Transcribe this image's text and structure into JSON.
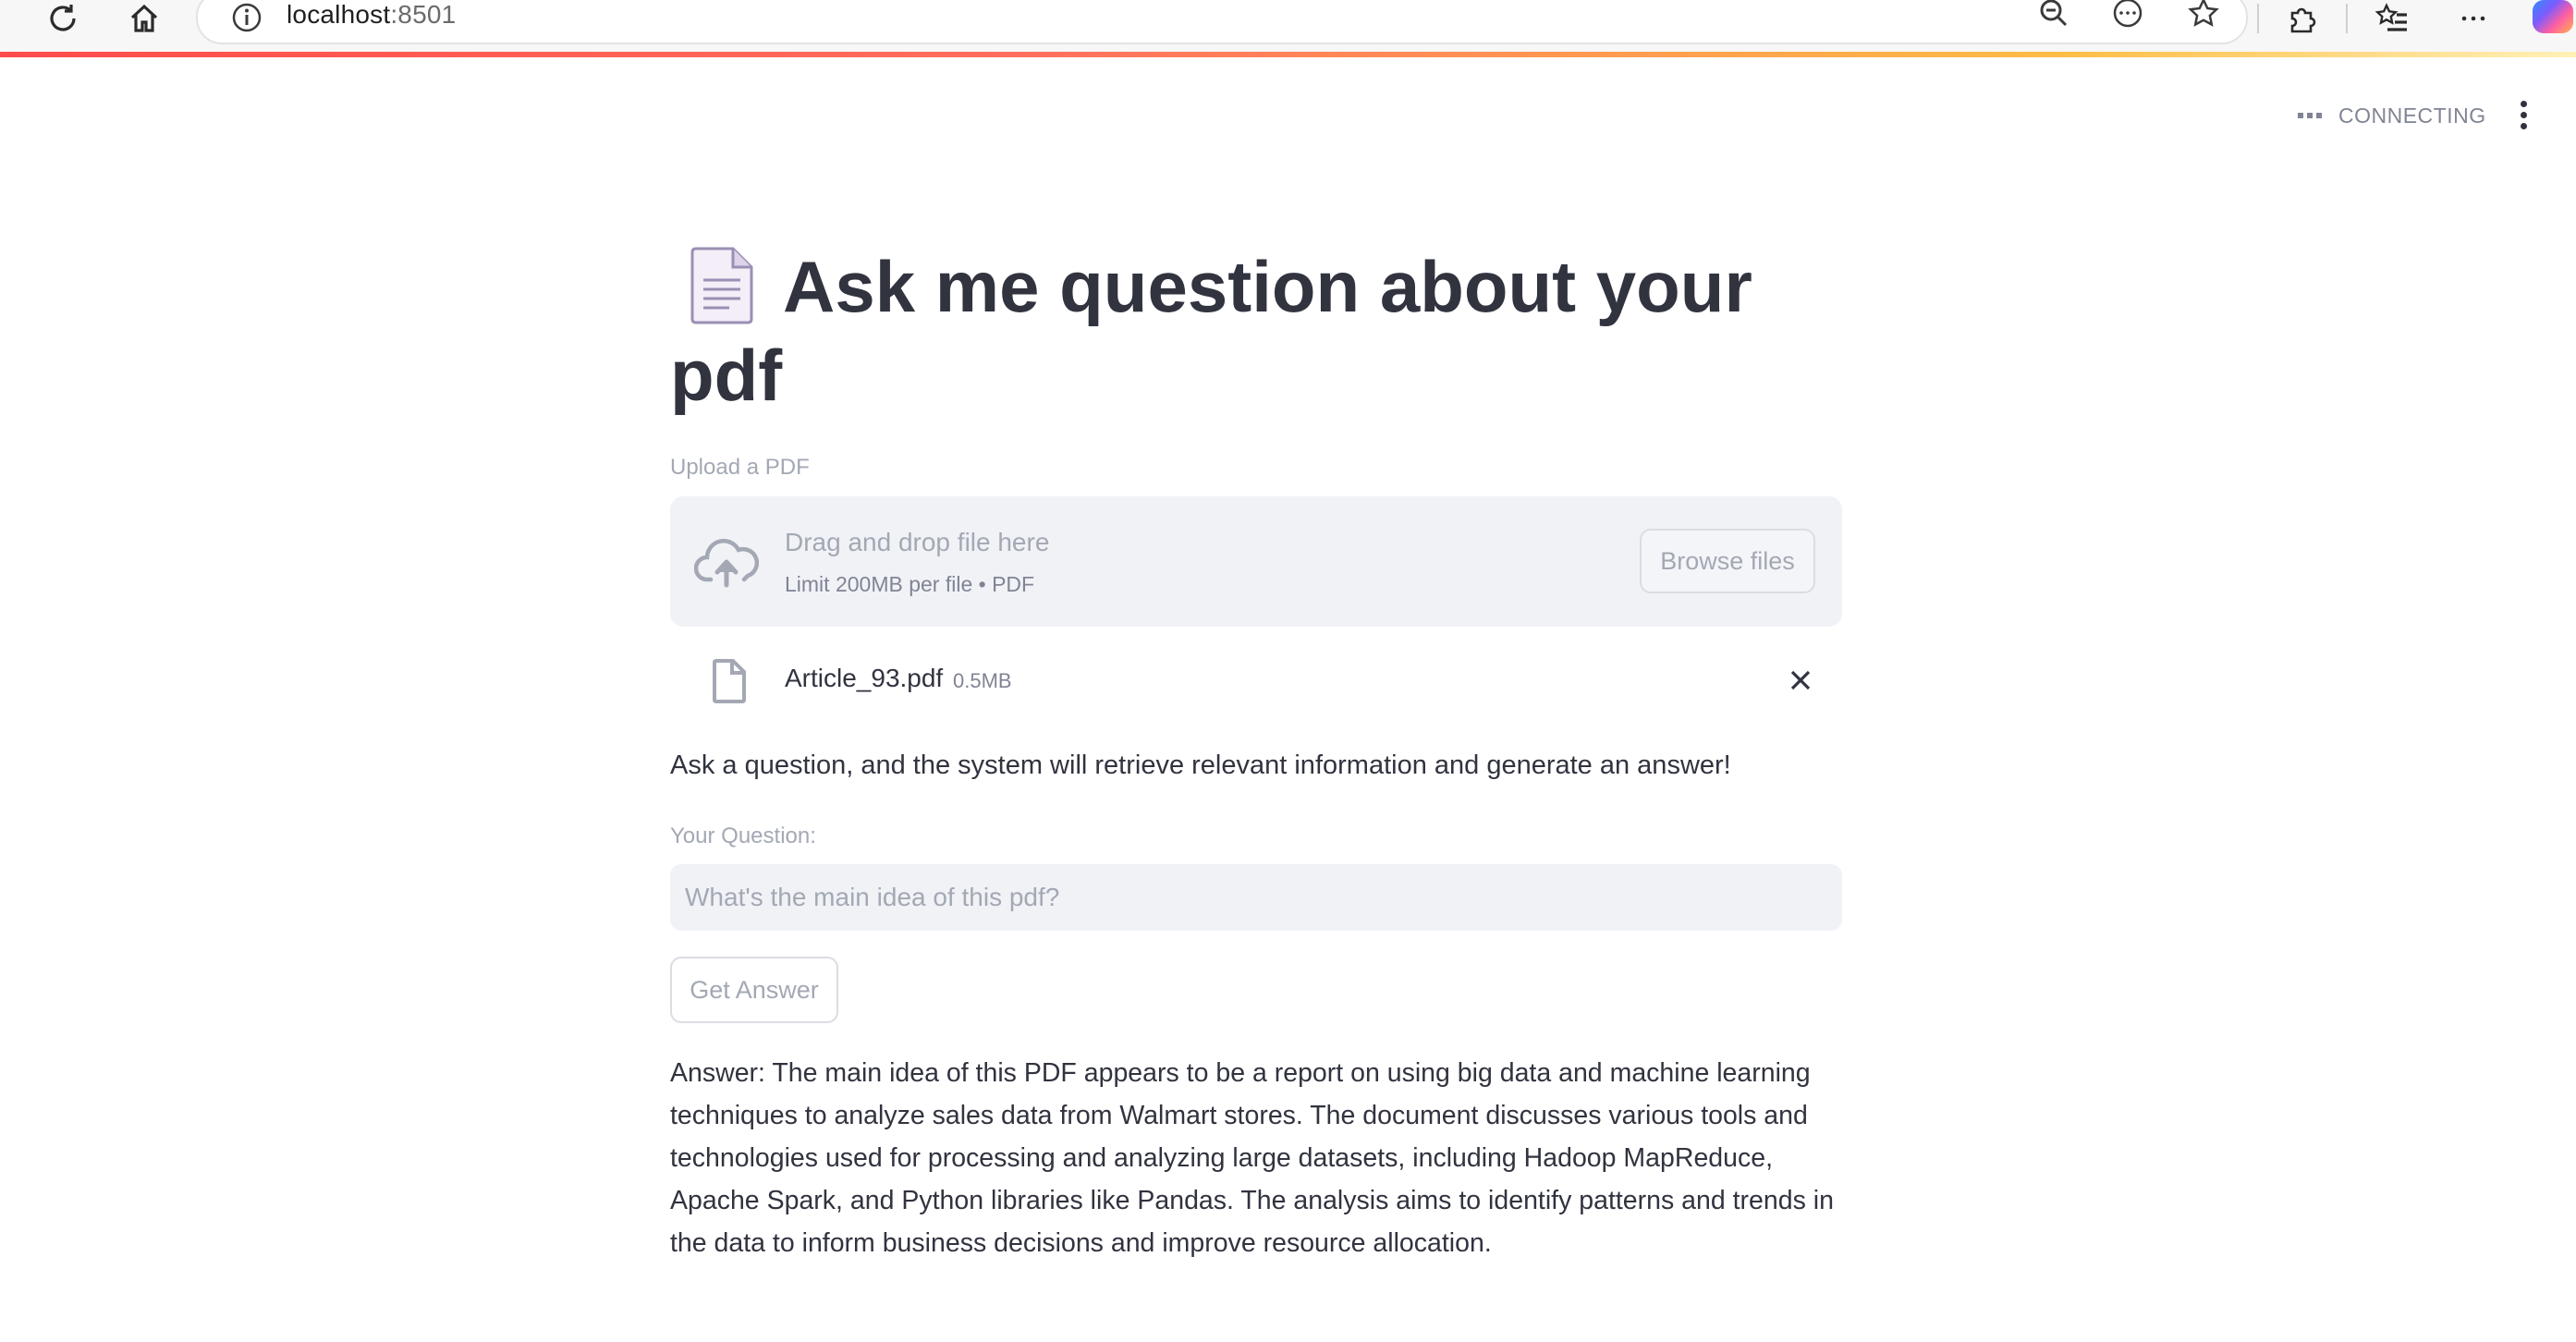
{
  "browser": {
    "url_host": "localhost",
    "url_port": ":8501"
  },
  "header": {
    "status": "CONNECTING"
  },
  "page": {
    "title": "Ask me question about your pdf",
    "title_icon": "page-facing-up-icon"
  },
  "uploader": {
    "label": "Upload a PDF",
    "drop_text": "Drag and drop file here",
    "limit_text": "Limit 200MB per file • PDF",
    "browse_label": "Browse files",
    "file": {
      "name": "Article_93.pdf",
      "size": "0.5MB"
    }
  },
  "info_text": "Ask a question, and the system will retrieve relevant information and generate an answer!",
  "question": {
    "label": "Your Question:",
    "value": "",
    "placeholder": "What's the main idea of this pdf?"
  },
  "answer_button": "Get Answer",
  "answer": "Answer: The main idea of this PDF appears to be a report on using big data and machine learning techniques to analyze sales data from Walmart stores. The document discusses various tools and technologies used for processing and analyzing large datasets, including Hadoop MapReduce, Apache Spark, and Python libraries like Pandas. The analysis aims to identify patterns and trends in the data to inform business decisions and improve resource allocation.",
  "colors": {
    "text": "#31333f",
    "muted": "#a3a8b4",
    "widget_bg": "#f0f2f6",
    "accent": "#ff4b4b"
  }
}
